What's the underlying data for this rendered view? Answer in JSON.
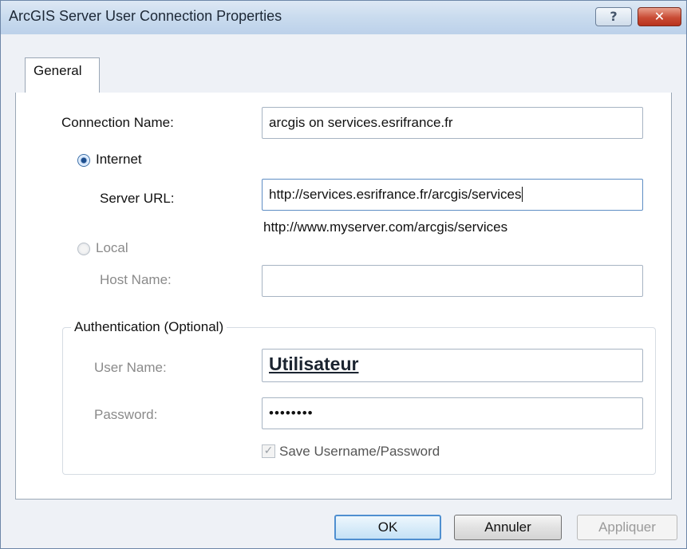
{
  "window": {
    "title": "ArcGIS Server User Connection Properties",
    "help_label": "?",
    "close_label": "✕"
  },
  "tabs": [
    {
      "label": "General",
      "selected": true
    }
  ],
  "form": {
    "connection_name_label": "Connection Name:",
    "connection_name_value": "arcgis on services.esrifrance.fr",
    "internet_label": "Internet",
    "internet_selected": true,
    "server_url_label": "Server URL:",
    "server_url_value": "http://services.esrifrance.fr/arcgis/services",
    "server_url_hint": "http://www.myserver.com/arcgis/services",
    "local_label": "Local",
    "local_selected": false,
    "host_name_label": "Host Name:",
    "host_name_value": ""
  },
  "authentication": {
    "legend": "Authentication (Optional)",
    "user_name_label": "User Name:",
    "user_name_value": "Utilisateur",
    "password_label": "Password:",
    "password_value": "••••••••",
    "save_label": "Save Username/Password",
    "save_checked": true
  },
  "buttons": {
    "ok": "OK",
    "cancel": "Annuler",
    "apply": "Appliquer"
  }
}
